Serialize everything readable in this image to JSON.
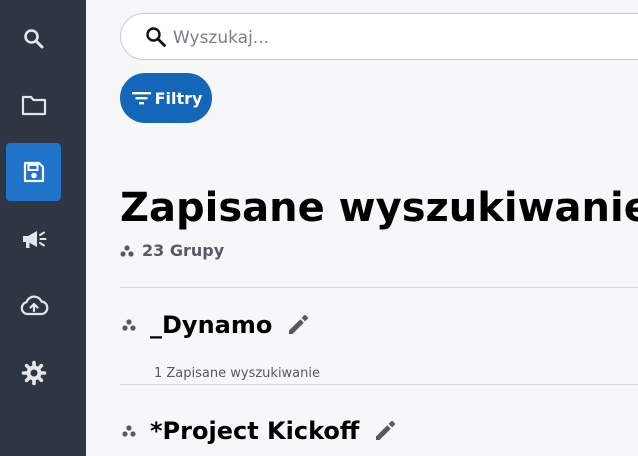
{
  "search": {
    "placeholder": "Wyszukaj..."
  },
  "filters": {
    "label": "Filtry"
  },
  "page": {
    "title": "Zapisane wyszukiwanie",
    "group_count": "23 Grupy"
  },
  "sidebar": {
    "items": [
      {
        "icon": "search-icon",
        "active": false
      },
      {
        "icon": "folder-icon",
        "active": false
      },
      {
        "icon": "save-icon",
        "active": true
      },
      {
        "icon": "megaphone-icon",
        "active": false
      },
      {
        "icon": "cloud-upload-icon",
        "active": false
      },
      {
        "icon": "gear-icon",
        "active": false
      }
    ]
  },
  "groups": [
    {
      "name": "_Dynamo",
      "subtitle": "1 Zapisane wyszukiwanie"
    },
    {
      "name": "*Project Kickoff",
      "subtitle": ""
    }
  ],
  "colors": {
    "sidebar_bg": "#2d3641",
    "accent": "#1f73c9",
    "filter_button": "#1366b8"
  }
}
